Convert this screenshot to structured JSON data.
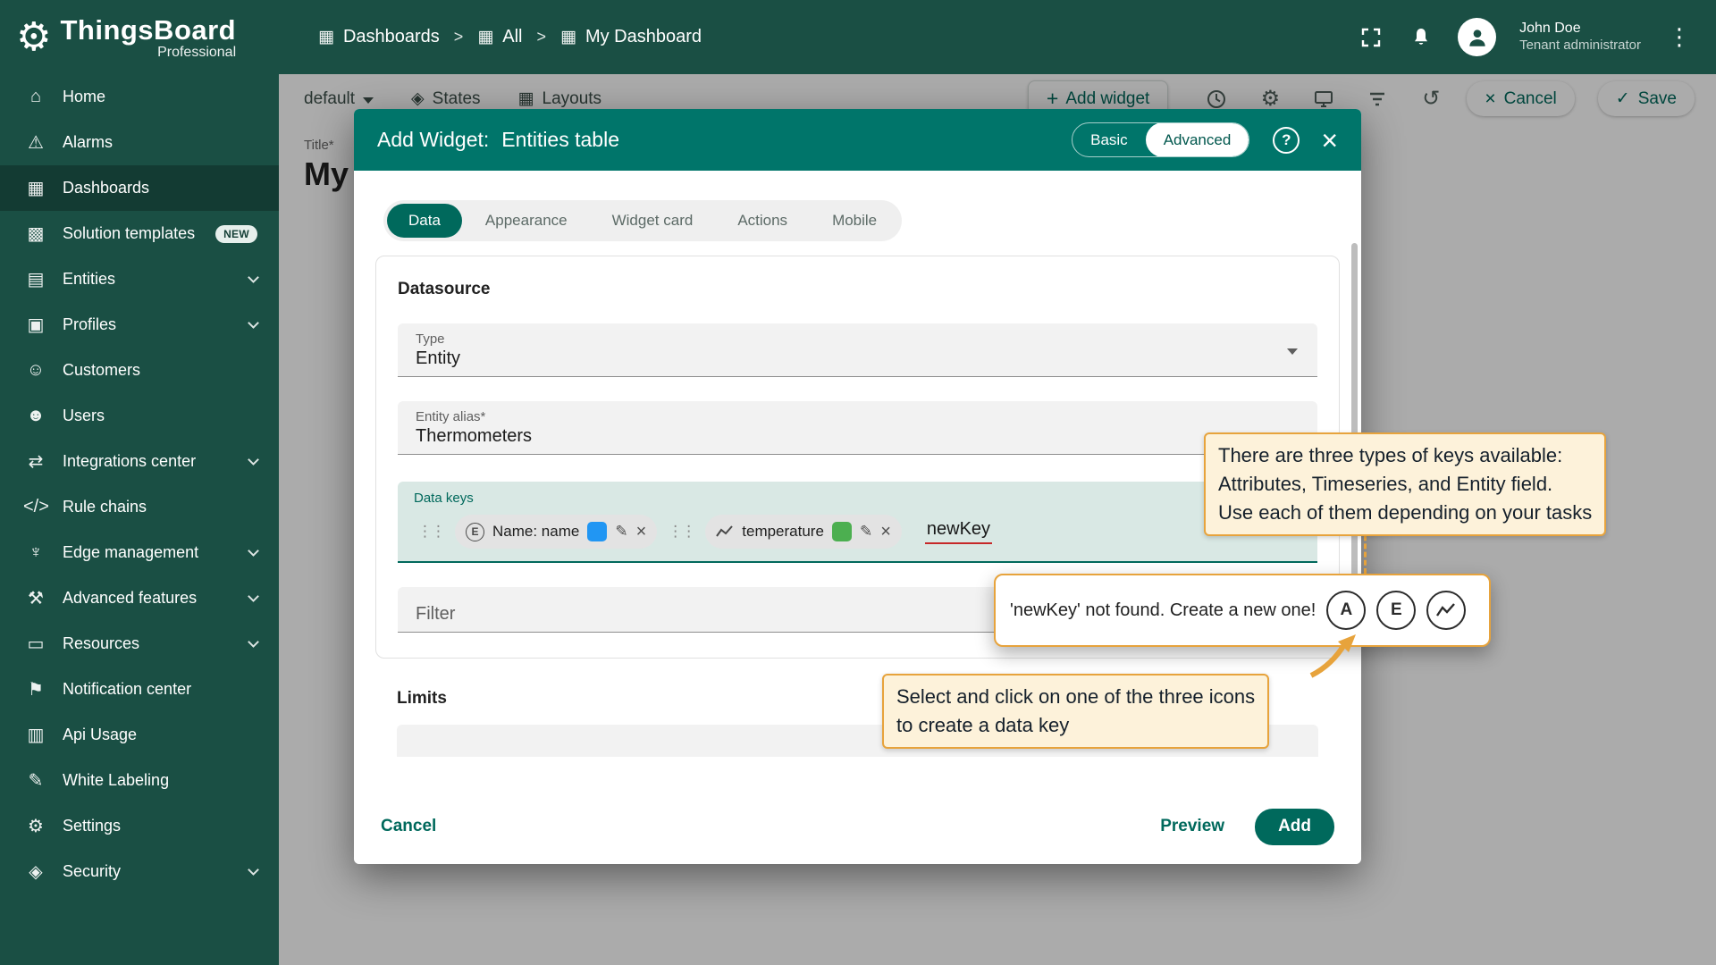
{
  "app": {
    "name": "ThingsBoard",
    "edition": "Professional"
  },
  "topbar": {
    "breadcrumbs": [
      "Dashboards",
      "All",
      "My Dashboard"
    ],
    "user_name": "John Doe",
    "user_role": "Tenant administrator"
  },
  "toolbar": {
    "state_selector": "default",
    "states": "States",
    "layouts": "Layouts",
    "add_widget": "Add widget",
    "cancel": "Cancel",
    "save": "Save"
  },
  "sidebar": {
    "items": [
      {
        "label": "Home"
      },
      {
        "label": "Alarms"
      },
      {
        "label": "Dashboards"
      },
      {
        "label": "Solution templates",
        "badge": "NEW"
      },
      {
        "label": "Entities"
      },
      {
        "label": "Profiles"
      },
      {
        "label": "Customers"
      },
      {
        "label": "Users"
      },
      {
        "label": "Integrations center"
      },
      {
        "label": "Rule chains"
      },
      {
        "label": "Edge management"
      },
      {
        "label": "Advanced features"
      },
      {
        "label": "Resources"
      },
      {
        "label": "Notification center"
      },
      {
        "label": "Api Usage"
      },
      {
        "label": "White Labeling"
      },
      {
        "label": "Settings"
      },
      {
        "label": "Security"
      }
    ]
  },
  "page": {
    "title_label": "Title*",
    "title_value": "My"
  },
  "dialog": {
    "title_prefix": "Add Widget:",
    "widget_name": "Entities table",
    "mode": {
      "basic": "Basic",
      "advanced": "Advanced"
    },
    "tabs": [
      "Data",
      "Appearance",
      "Widget card",
      "Actions",
      "Mobile"
    ],
    "datasource": {
      "heading": "Datasource",
      "type_label": "Type",
      "type_value": "Entity",
      "alias_label": "Entity alias*",
      "alias_value": "Thermometers",
      "data_keys_label": "Data keys",
      "keys": [
        {
          "label": "Name: name",
          "color": "#2196f3",
          "type": "entity-field"
        },
        {
          "label": "temperature",
          "color": "#4caf50",
          "type": "timeseries"
        }
      ],
      "new_key_text": "newKey",
      "filter_label": "Filter"
    },
    "limits_heading": "Limits",
    "footer": {
      "cancel": "Cancel",
      "preview": "Preview",
      "add": "Add"
    }
  },
  "callouts": {
    "keys_info": {
      "lines": [
        "There are three types of keys available:",
        "Attributes, Timeseries, and Entity field.",
        "Use each of them depending on your tasks"
      ]
    },
    "not_found": {
      "text": "'newKey' not found. Create a new one!",
      "icons": [
        "attribute",
        "entity-field",
        "timeseries"
      ]
    },
    "select_hint": {
      "lines": [
        "Select and click on one of the three icons",
        "to create a data key"
      ]
    }
  },
  "colors": {
    "accent": "#00695c",
    "sidebar_bg": "#1a4f44",
    "dialog_header": "#00756a",
    "callout_border": "#e7a33c",
    "callout_bg": "#fdf2da",
    "key_blue": "#2196f3",
    "key_green": "#4caf50",
    "error_underline": "#c62828"
  }
}
